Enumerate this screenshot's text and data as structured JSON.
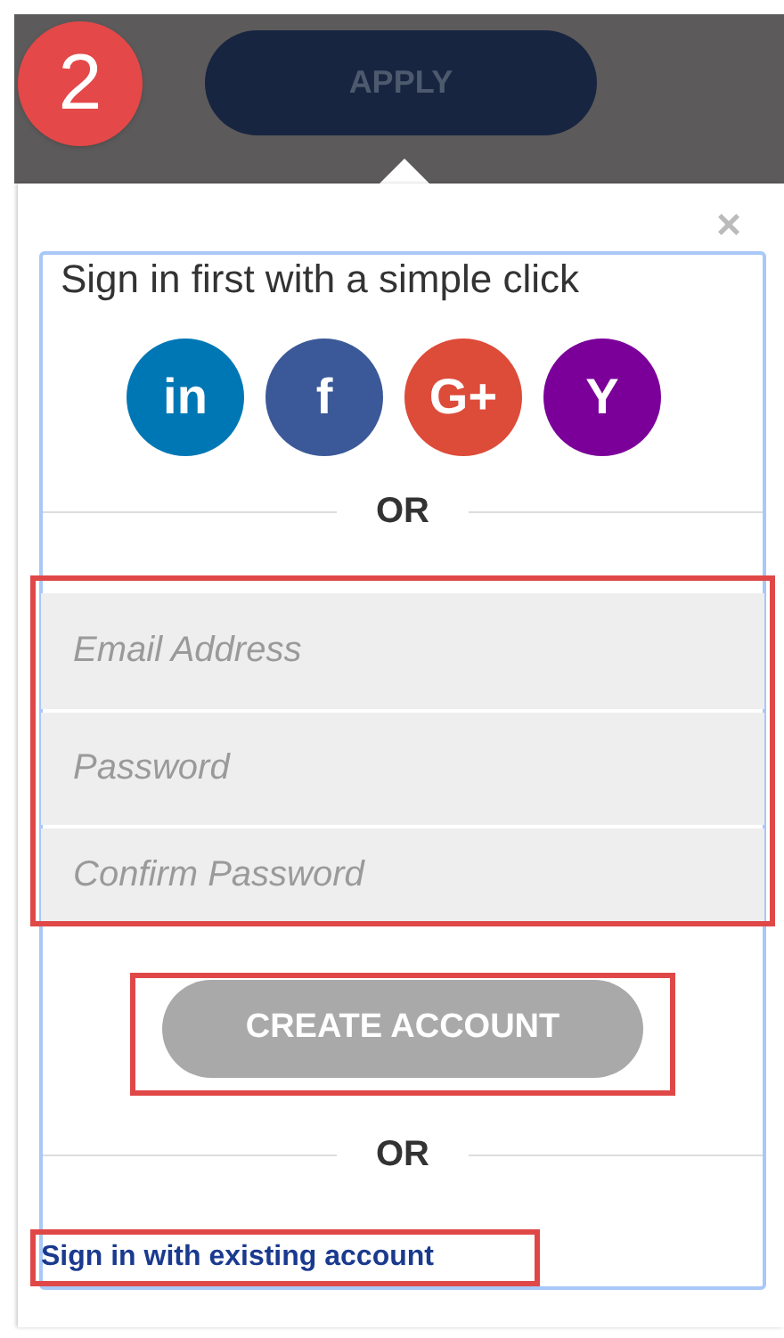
{
  "top_bar": {
    "step_badge": "2",
    "apply_button": {
      "label": "APPLY"
    }
  },
  "popup": {
    "close": "×",
    "heading": "Sign in first with a simple click",
    "social_buttons": [
      {
        "label": "in",
        "color": "#0077b5"
      },
      {
        "label": "f",
        "color": "#3b5998"
      },
      {
        "label": "G+",
        "color": "#dd4b39"
      },
      {
        "label": "Y",
        "color": "#7b0099"
      }
    ],
    "divider_1": "OR",
    "fields": [
      {
        "placeholder": "Email Address"
      },
      {
        "placeholder": "Password"
      },
      {
        "placeholder": "Confirm Password"
      }
    ],
    "create_button": {
      "label": "CREATE ACCOUNT",
      "disabled": true
    },
    "divider_2": "OR",
    "signin_link": "Sign in with existing account"
  }
}
